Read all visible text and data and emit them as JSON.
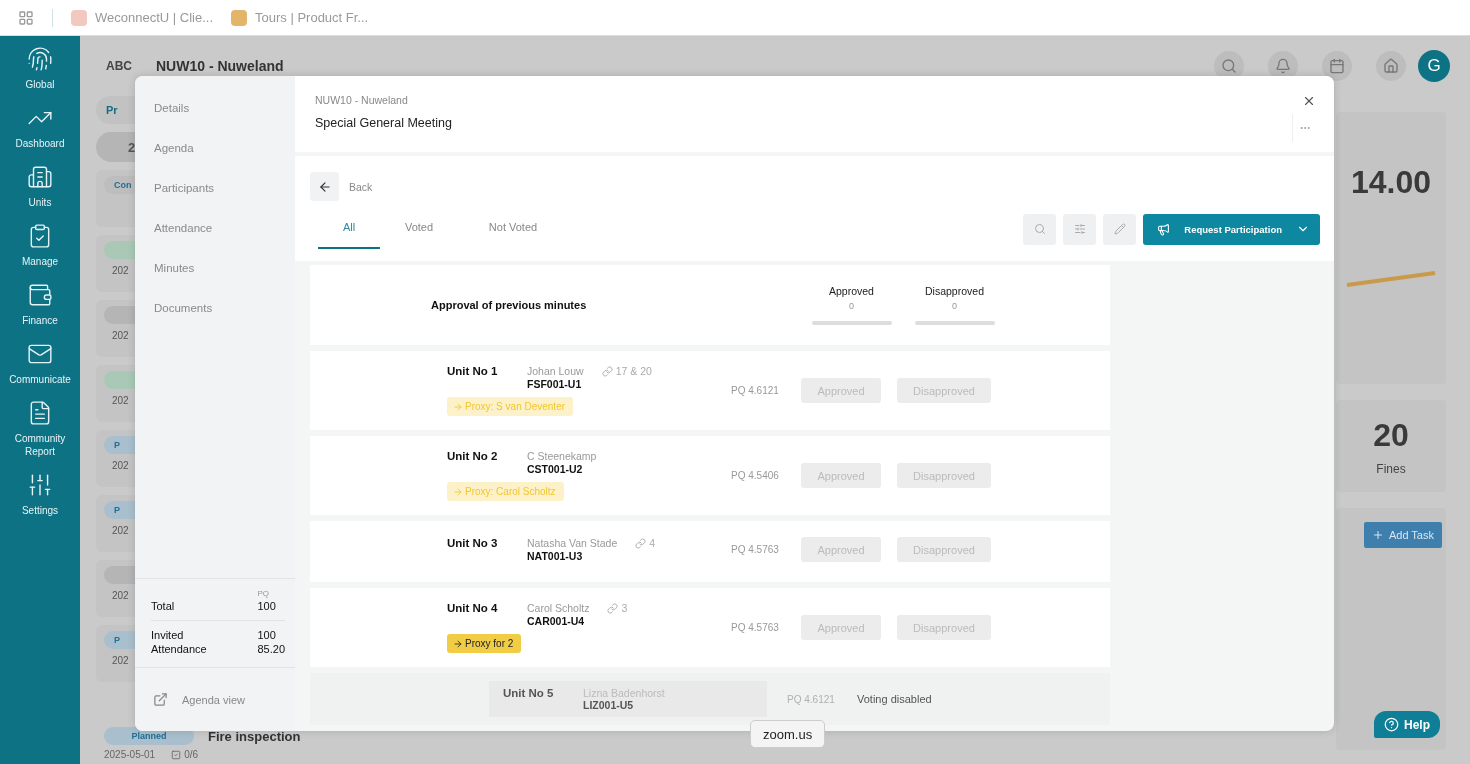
{
  "browser_tabs": [
    {
      "title": "WeconnectU | Clie..."
    },
    {
      "title": "Tours | Product Fr..."
    }
  ],
  "nav": [
    {
      "label": "Global"
    },
    {
      "label": "Dashboard"
    },
    {
      "label": "Units"
    },
    {
      "label": "Manage"
    },
    {
      "label": "Finance"
    },
    {
      "label": "Communicate"
    },
    {
      "label": "Community Report"
    },
    {
      "label": "Settings"
    }
  ],
  "header": {
    "logo": "ABC",
    "title": "NUW10 - Nuweland",
    "avatar": "G"
  },
  "background": {
    "filter_chip": "Pr",
    "count": "2",
    "cards": [
      {
        "badge": "Con",
        "color": "#bdbdbd"
      },
      {
        "color": "#a9c9b6",
        "date": "202"
      },
      {
        "color": "#b5b5b5",
        "date": "202"
      },
      {
        "color": "#a9c9b6",
        "date": "202"
      },
      {
        "badge": "P",
        "color": "#a9bfcd",
        "date": "202"
      },
      {
        "badge": "P",
        "color": "#a9bfcd",
        "date": "202"
      },
      {
        "color": "#b5b5b5",
        "date": "202"
      },
      {
        "badge": "P",
        "color": "#a9bfcd",
        "date": "202"
      }
    ],
    "last_card": {
      "badge": "Planned",
      "title": "Fire inspection",
      "date": "2025-05-01",
      "tasks": "0/6"
    },
    "stats": [
      {
        "value": "14.00"
      },
      {
        "value": "20",
        "label": "Fines"
      }
    ],
    "add_task": "Add Task",
    "help": "Help"
  },
  "modal": {
    "nav": [
      "Details",
      "Agenda",
      "Participants",
      "Attendance",
      "Minutes",
      "Documents"
    ],
    "totals": {
      "column": "PQ",
      "rows": [
        {
          "label": "Total",
          "value": "100"
        },
        {
          "label": "Invited",
          "value": "100"
        },
        {
          "label": "Attendance",
          "value": "85.20"
        }
      ]
    },
    "agenda_view": "Agenda view",
    "subtitle": "NUW10 - Nuweland",
    "title": "Special General Meeting",
    "back": "Back",
    "tabs": [
      {
        "label": "All",
        "selected": true
      },
      {
        "label": "Voted",
        "selected": false
      },
      {
        "label": "Not Voted",
        "selected": false
      }
    ],
    "request_button": "Request Participation",
    "question": {
      "text": "Approval of previous minutes",
      "tallies": [
        {
          "label": "Approved",
          "count": "0",
          "level": 0
        },
        {
          "label": "Disapproved",
          "count": "0",
          "level": 0
        }
      ]
    },
    "rows": [
      {
        "unit": "Unit No 1",
        "owner": "Johan Louw",
        "code": "FSF001-U1",
        "links": "17 & 20",
        "proxy": {
          "kind": "from",
          "text": "Proxy: S van Deventer"
        },
        "pq": "PQ 4.6121",
        "disabled": false,
        "vote_buttons": [
          "Approved",
          "Disapproved"
        ]
      },
      {
        "unit": "Unit No 2",
        "owner": "C Steenekamp",
        "code": "CST001-U2",
        "proxy": {
          "kind": "from",
          "text": "Proxy: Carol Scholtz"
        },
        "pq": "PQ 4.5406",
        "disabled": false,
        "vote_buttons": [
          "Approved",
          "Disapproved"
        ]
      },
      {
        "unit": "Unit No 3",
        "owner": "Natasha Van Stade",
        "code": "NAT001-U3",
        "links": "4",
        "pq": "PQ 4.5763",
        "disabled": false,
        "vote_buttons": [
          "Approved",
          "Disapproved"
        ]
      },
      {
        "unit": "Unit No 4",
        "owner": "Carol Scholtz",
        "code": "CAR001-U4",
        "links": "3",
        "proxy": {
          "kind": "for",
          "text": "Proxy for 2"
        },
        "pq": "PQ 4.5763",
        "disabled": false,
        "vote_buttons": [
          "Approved",
          "Disapproved"
        ]
      },
      {
        "unit": "Unit No 5",
        "owner": "Lizna Badenhorst",
        "code": "LIZ001-U5",
        "pq": "PQ 4.6121",
        "disabled": true,
        "note": "Voting disabled"
      }
    ]
  },
  "tooltip": "zoom.us"
}
